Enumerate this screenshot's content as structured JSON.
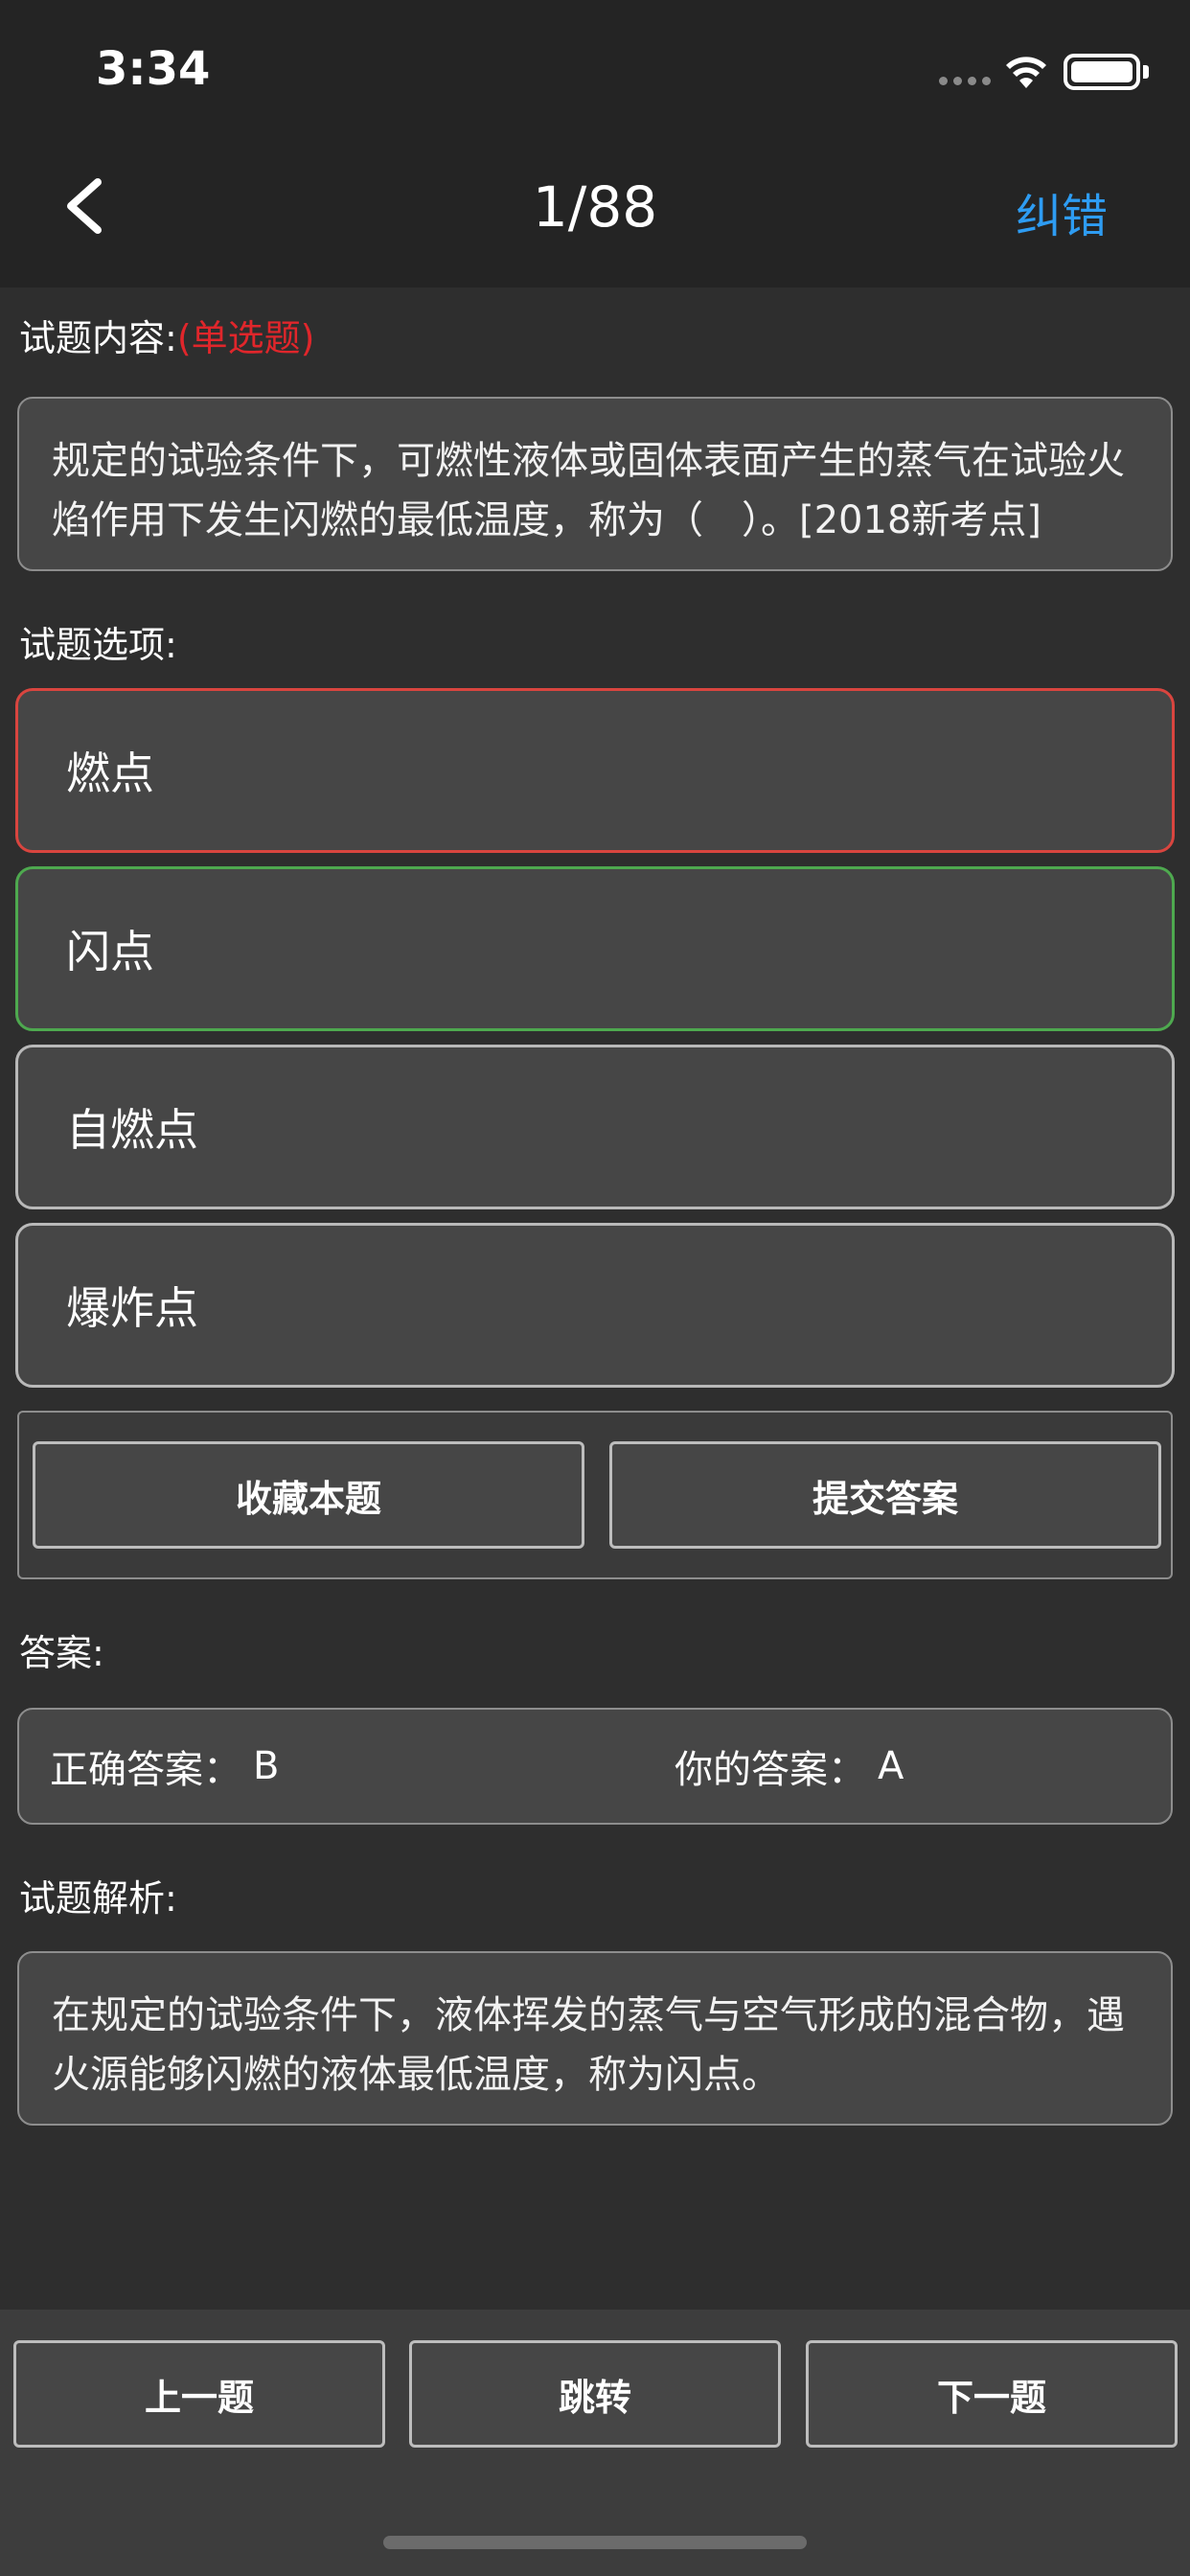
{
  "status_bar": {
    "time": "3:34"
  },
  "nav": {
    "title": "1/88",
    "action_label": "纠错",
    "back_icon": "chevron-left-icon"
  },
  "question": {
    "label": "试题内容:",
    "type_tag": "(单选题)",
    "text": "规定的试验条件下，可燃性液体或固体表面产生的蒸气在试验火焰作用下发生闪燃的最低温度，称为（　）。[2018新考点]"
  },
  "options_label": "试题选项:",
  "options": [
    {
      "text": "燃点",
      "state": "wrong"
    },
    {
      "text": "闪点",
      "state": "correct"
    },
    {
      "text": "自燃点",
      "state": "normal"
    },
    {
      "text": "爆炸点",
      "state": "normal"
    }
  ],
  "actions": {
    "favorite_label": "收藏本题",
    "submit_label": "提交答案"
  },
  "answer": {
    "label": "答案:",
    "correct_label": "正确答案：",
    "correct_value": "B",
    "yours_label": "你的答案：",
    "yours_value": "A"
  },
  "analysis": {
    "label": "试题解析:",
    "text": "在规定的试验条件下，液体挥发的蒸气与空气形成的混合物，遇火源能够闪燃的液体最低温度，称为闪点。"
  },
  "bottom_nav": {
    "prev_label": "上一题",
    "jump_label": "跳转",
    "next_label": "下一题"
  },
  "colors": {
    "accent": "#2e9cf2",
    "wrong": "#d9453f",
    "correct": "#4ea94f",
    "tag": "#e0262b"
  }
}
